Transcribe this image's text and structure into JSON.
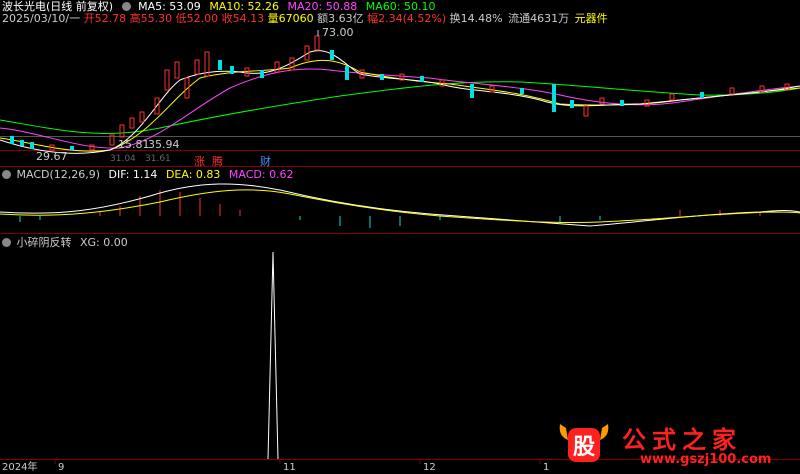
{
  "stock": {
    "name": "波长光电(日线 前复权)",
    "date": "2025/03/10/一",
    "open": "开52.78",
    "high": "高55.30",
    "low": "低52.00",
    "close": "收54.13",
    "volume": "量67060",
    "amount": "额3.63亿",
    "change": "幅2.34(4.52%)",
    "turnover": "换14.48%",
    "float": "流通4631万",
    "industry": "元器件"
  },
  "ma": {
    "ma5": {
      "label": "MA5: 53.09",
      "color": "#ffffff"
    },
    "ma10": {
      "label": "MA10: 52.26",
      "color": "#ffff00"
    },
    "ma20": {
      "label": "MA20: 50.88",
      "color": "#ff44ff"
    },
    "ma60": {
      "label": "MA60: 50.10",
      "color": "#00ff00"
    }
  },
  "price_labels": {
    "high_mark": "73.00",
    "low_mark": "29.67",
    "mid1": "15.81",
    "mid2": "35.94",
    "low2": "31.04",
    "low3": "31.61"
  },
  "tags": {
    "zhang": "涨",
    "teng": "腾",
    "cai": "财"
  },
  "macd": {
    "title": "MACD(12,26,9)",
    "dif": "DIF: 1.14",
    "dea": "DEA: 0.83",
    "macd": "MACD: 0.62"
  },
  "indicator": {
    "title": "小碎阴反转",
    "xg": "XG: 0.00"
  },
  "xaxis": {
    "year": "2024年",
    "m9": "9",
    "m11": "11",
    "m12": "12",
    "m1": "1"
  },
  "watermark": {
    "logo_char": "股",
    "text": "公式之家",
    "url": "www.gszj100.com"
  },
  "colors": {
    "up": "#ff3030",
    "down": "#00e0e0",
    "grid": "#800000",
    "bg": "#000000"
  }
}
